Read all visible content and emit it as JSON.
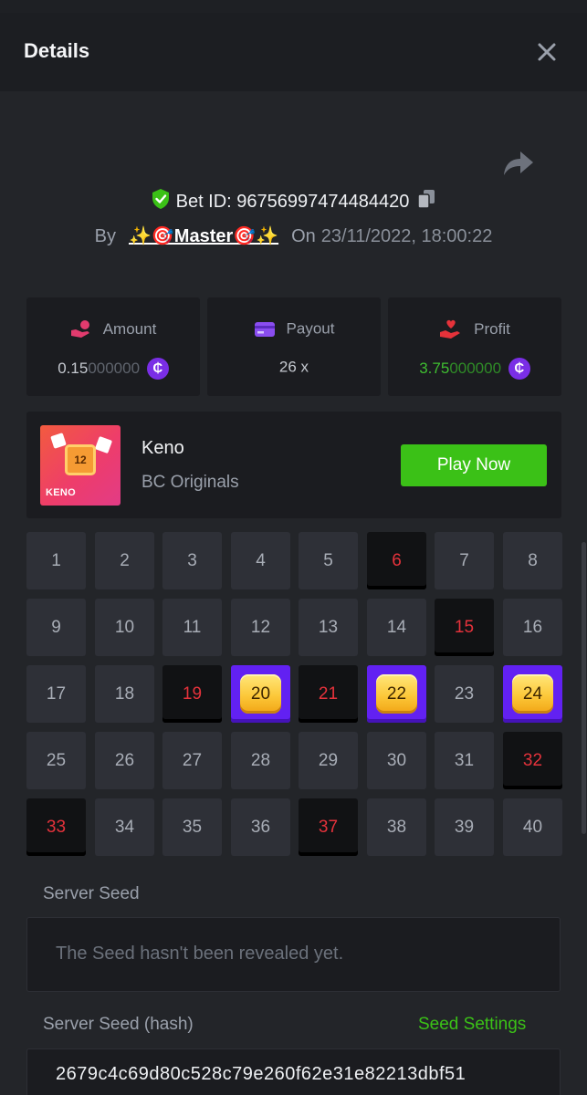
{
  "modal": {
    "title": "Details"
  },
  "bet": {
    "id_text": "Bet ID: 96756997474484420",
    "by_label": "By",
    "user": "✨🎯Master🎯✨",
    "on_label": "On",
    "date": "23/11/2022, 18:00:22"
  },
  "stats": {
    "amount": {
      "label": "Amount",
      "value_main": "0.15",
      "value_dim": "000000",
      "coin": "₵"
    },
    "payout": {
      "label": "Payout",
      "value": "26 x"
    },
    "profit": {
      "label": "Profit",
      "value_main": "3.75",
      "value_dim": "000000",
      "coin": "₵"
    }
  },
  "game": {
    "thumb_text": "KENO",
    "thumb_number": "12",
    "name": "Keno",
    "provider": "BC Originals",
    "play_label": "Play Now"
  },
  "keno": {
    "cells": [
      {
        "n": "1",
        "state": "normal"
      },
      {
        "n": "2",
        "state": "normal"
      },
      {
        "n": "3",
        "state": "normal"
      },
      {
        "n": "4",
        "state": "normal"
      },
      {
        "n": "5",
        "state": "normal"
      },
      {
        "n": "6",
        "state": "miss"
      },
      {
        "n": "7",
        "state": "normal"
      },
      {
        "n": "8",
        "state": "normal"
      },
      {
        "n": "9",
        "state": "normal"
      },
      {
        "n": "10",
        "state": "normal"
      },
      {
        "n": "11",
        "state": "normal"
      },
      {
        "n": "12",
        "state": "normal"
      },
      {
        "n": "13",
        "state": "normal"
      },
      {
        "n": "14",
        "state": "normal"
      },
      {
        "n": "15",
        "state": "miss"
      },
      {
        "n": "16",
        "state": "normal"
      },
      {
        "n": "17",
        "state": "normal"
      },
      {
        "n": "18",
        "state": "normal"
      },
      {
        "n": "19",
        "state": "miss"
      },
      {
        "n": "20",
        "state": "hit"
      },
      {
        "n": "21",
        "state": "miss"
      },
      {
        "n": "22",
        "state": "hit"
      },
      {
        "n": "23",
        "state": "normal"
      },
      {
        "n": "24",
        "state": "hit"
      },
      {
        "n": "25",
        "state": "normal"
      },
      {
        "n": "26",
        "state": "normal"
      },
      {
        "n": "27",
        "state": "normal"
      },
      {
        "n": "28",
        "state": "normal"
      },
      {
        "n": "29",
        "state": "normal"
      },
      {
        "n": "30",
        "state": "normal"
      },
      {
        "n": "31",
        "state": "normal"
      },
      {
        "n": "32",
        "state": "miss"
      },
      {
        "n": "33",
        "state": "miss"
      },
      {
        "n": "34",
        "state": "normal"
      },
      {
        "n": "35",
        "state": "normal"
      },
      {
        "n": "36",
        "state": "normal"
      },
      {
        "n": "37",
        "state": "miss"
      },
      {
        "n": "38",
        "state": "normal"
      },
      {
        "n": "39",
        "state": "normal"
      },
      {
        "n": "40",
        "state": "normal"
      }
    ]
  },
  "seeds": {
    "server_seed_label": "Server Seed",
    "server_seed_placeholder": "The Seed hasn't been revealed yet.",
    "server_hash_label": "Server Seed (hash)",
    "seed_settings_label": "Seed Settings",
    "server_hash_value": "2679c4c69d80c528c79e260f62e31e82213dbf51"
  },
  "icons": {
    "close": "close-icon",
    "share": "share-icon",
    "shield": "shield-check-icon",
    "copy": "copy-icon",
    "amount": "hand-coins-icon",
    "payout": "card-icon",
    "profit": "hand-heart-icon"
  },
  "colors": {
    "accent_green": "#3bc117",
    "hit_purple": "#6221f2",
    "miss_red": "#e4323b",
    "coin_purple": "#7a2ee6"
  }
}
